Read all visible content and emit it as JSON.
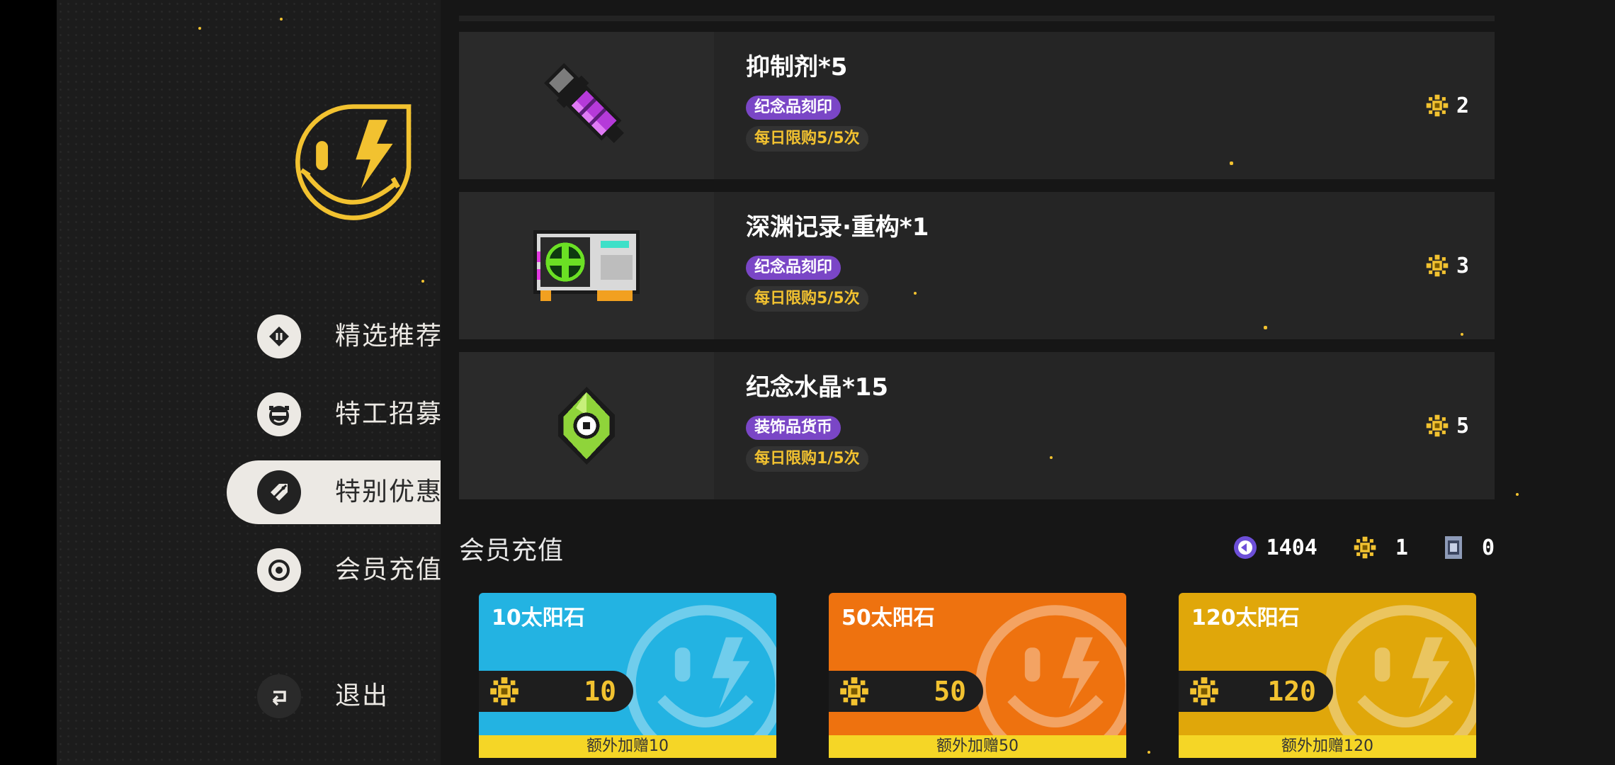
{
  "sidebar": {
    "logo": "smiley-bolt-logo",
    "items": [
      {
        "label": "精选推荐",
        "icon": "ticket-icon",
        "active": false
      },
      {
        "label": "特工招募",
        "icon": "agent-face-icon",
        "active": false
      },
      {
        "label": "特别优惠",
        "icon": "sale-tag-icon",
        "active": true
      },
      {
        "label": "会员充值",
        "icon": "coin-icon",
        "active": false
      }
    ],
    "exit_label": "退出"
  },
  "offers": [
    {
      "title": "抑制剂*5",
      "tag": "纪念品刻印",
      "limit": "每日限购5/5次",
      "price": "2",
      "image": "inhibitor-vial-icon"
    },
    {
      "title": "深渊记录·重构*1",
      "tag": "纪念品刻印",
      "limit": "每日限购5/5次",
      "price": "3",
      "image": "abyss-record-chip-icon"
    },
    {
      "title": "纪念水晶*15",
      "tag": "装饰品货币",
      "limit": "每日限购1/5次",
      "price": "5",
      "image": "memorial-crystal-icon"
    }
  ],
  "recharge": {
    "title": "会员充值",
    "balances": {
      "tokens": "1404",
      "sunstones": "1",
      "vouchers": "0"
    },
    "cards": [
      {
        "title": "10太阳石",
        "value": "10",
        "bonus": "额外加赠10",
        "color": "#23b3e2"
      },
      {
        "title": "50太阳石",
        "value": "50",
        "bonus": "额外加赠50",
        "color": "#ee720f"
      },
      {
        "title": "120太阳石",
        "value": "120",
        "bonus": "额外加赠120",
        "color": "#e0a70a"
      }
    ]
  },
  "colors": {
    "accent_yellow": "#f2c230",
    "tag_purple": "#7a46c6",
    "sidebar_bg": "#1c1c1c"
  }
}
